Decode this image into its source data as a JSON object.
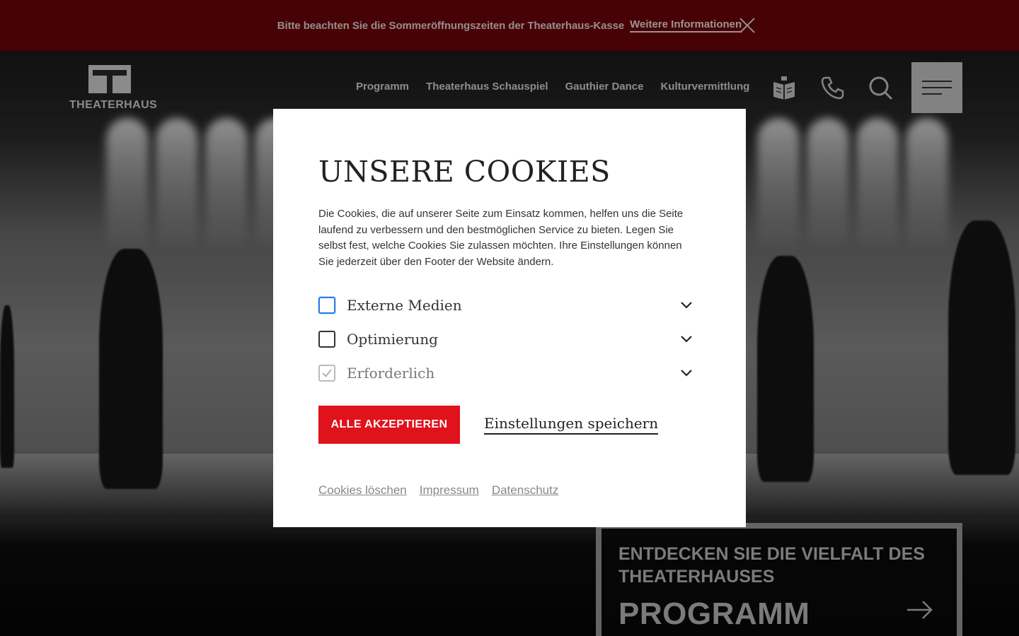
{
  "announcement": {
    "text": "Bitte beachten Sie die Sommeröffnungszeiten der Theaterhaus-Kasse",
    "link_label": "Weitere Informationen",
    "background": "#6e0409"
  },
  "header": {
    "logo_text": "THEATERHAUS",
    "nav": [
      {
        "label": "Programm"
      },
      {
        "label": "Theaterhaus Schauspiel"
      },
      {
        "label": "Gauthier Dance"
      },
      {
        "label": "Kulturvermittlung"
      }
    ],
    "icons": [
      "magazine-icon",
      "phone-icon",
      "search-icon",
      "menu-icon"
    ]
  },
  "teaser": {
    "subtitle": "Entdecken Sie die Vielfalt des Theaterhauses",
    "title": "PROGRAMM"
  },
  "cookie_modal": {
    "title": "UNSERE COOKIES",
    "description": "Die Cookies, die auf unserer Seite zum Einsatz kommen, helfen uns die Seite laufend zu verbessern und den bestmöglichen Service zu bieten. Legen Sie selbst fest, welche Cookies Sie zulassen möchten. Ihre Einstellungen können Sie jederzeit über den Footer der Website ändern.",
    "options": [
      {
        "label": "Externe Medien",
        "checked": false
      },
      {
        "label": "Optimierung",
        "checked": false
      },
      {
        "label": "Erforderlich",
        "checked": true,
        "disabled": true
      }
    ],
    "accept_all_label": "Alle akzeptieren",
    "save_label": "Einstellungen speichern",
    "footer_links": [
      "Cookies löschen",
      "Impressum",
      "Datenschutz"
    ],
    "accent_color": "#e0121b"
  }
}
